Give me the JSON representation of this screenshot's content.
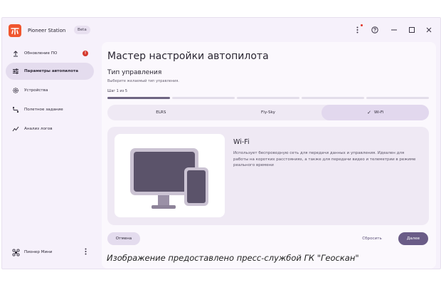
{
  "window": {
    "app_name": "Pioneer Station",
    "beta_label": "Beta",
    "controls": [
      "kebab-icon",
      "help-icon",
      "minimize-icon",
      "maximize-icon",
      "close-icon"
    ]
  },
  "sidebar": {
    "items": [
      {
        "label": "Обновление ПО",
        "icon": "upload-icon",
        "badge": "!"
      },
      {
        "label": "Параметры автопилота",
        "icon": "sliders-icon",
        "active": true
      },
      {
        "label": "Устройства",
        "icon": "gear-icon"
      },
      {
        "label": "Полетное задание",
        "icon": "route-icon"
      },
      {
        "label": "Анализ логов",
        "icon": "chart-line-icon"
      }
    ],
    "account": {
      "label": "Пионер Мини",
      "icon": "drone-icon"
    }
  },
  "main": {
    "title": "Мастер настройки автопилота",
    "section_title": "Тип управления",
    "section_subtitle": "Выберите желаемый тип управления.",
    "step_label": "Шаг 1 из 5",
    "progress": {
      "current": 1,
      "total": 5
    },
    "options": [
      {
        "label": "ELRS"
      },
      {
        "label": "Fly-Sky"
      },
      {
        "label": "Wi-Fi",
        "selected": true
      }
    ],
    "card": {
      "title": "Wi-Fi",
      "description": "Использует беспроводную сеть для передачи данных и управления. Идеален для работы на коротких расстояниях, а также для передачи видео и телеметрии в режиме реального времени"
    },
    "buttons": {
      "cancel": "Отмена",
      "reset": "Сбросить",
      "next": "Далее"
    }
  },
  "caption": "Изображение предоставлено пресс-службой ГК \"Геоскан\"",
  "colors": {
    "accent": "#6a5c87",
    "logo": "#f0562f",
    "badge": "#d4382c",
    "active_nav": "#e4dcee"
  }
}
